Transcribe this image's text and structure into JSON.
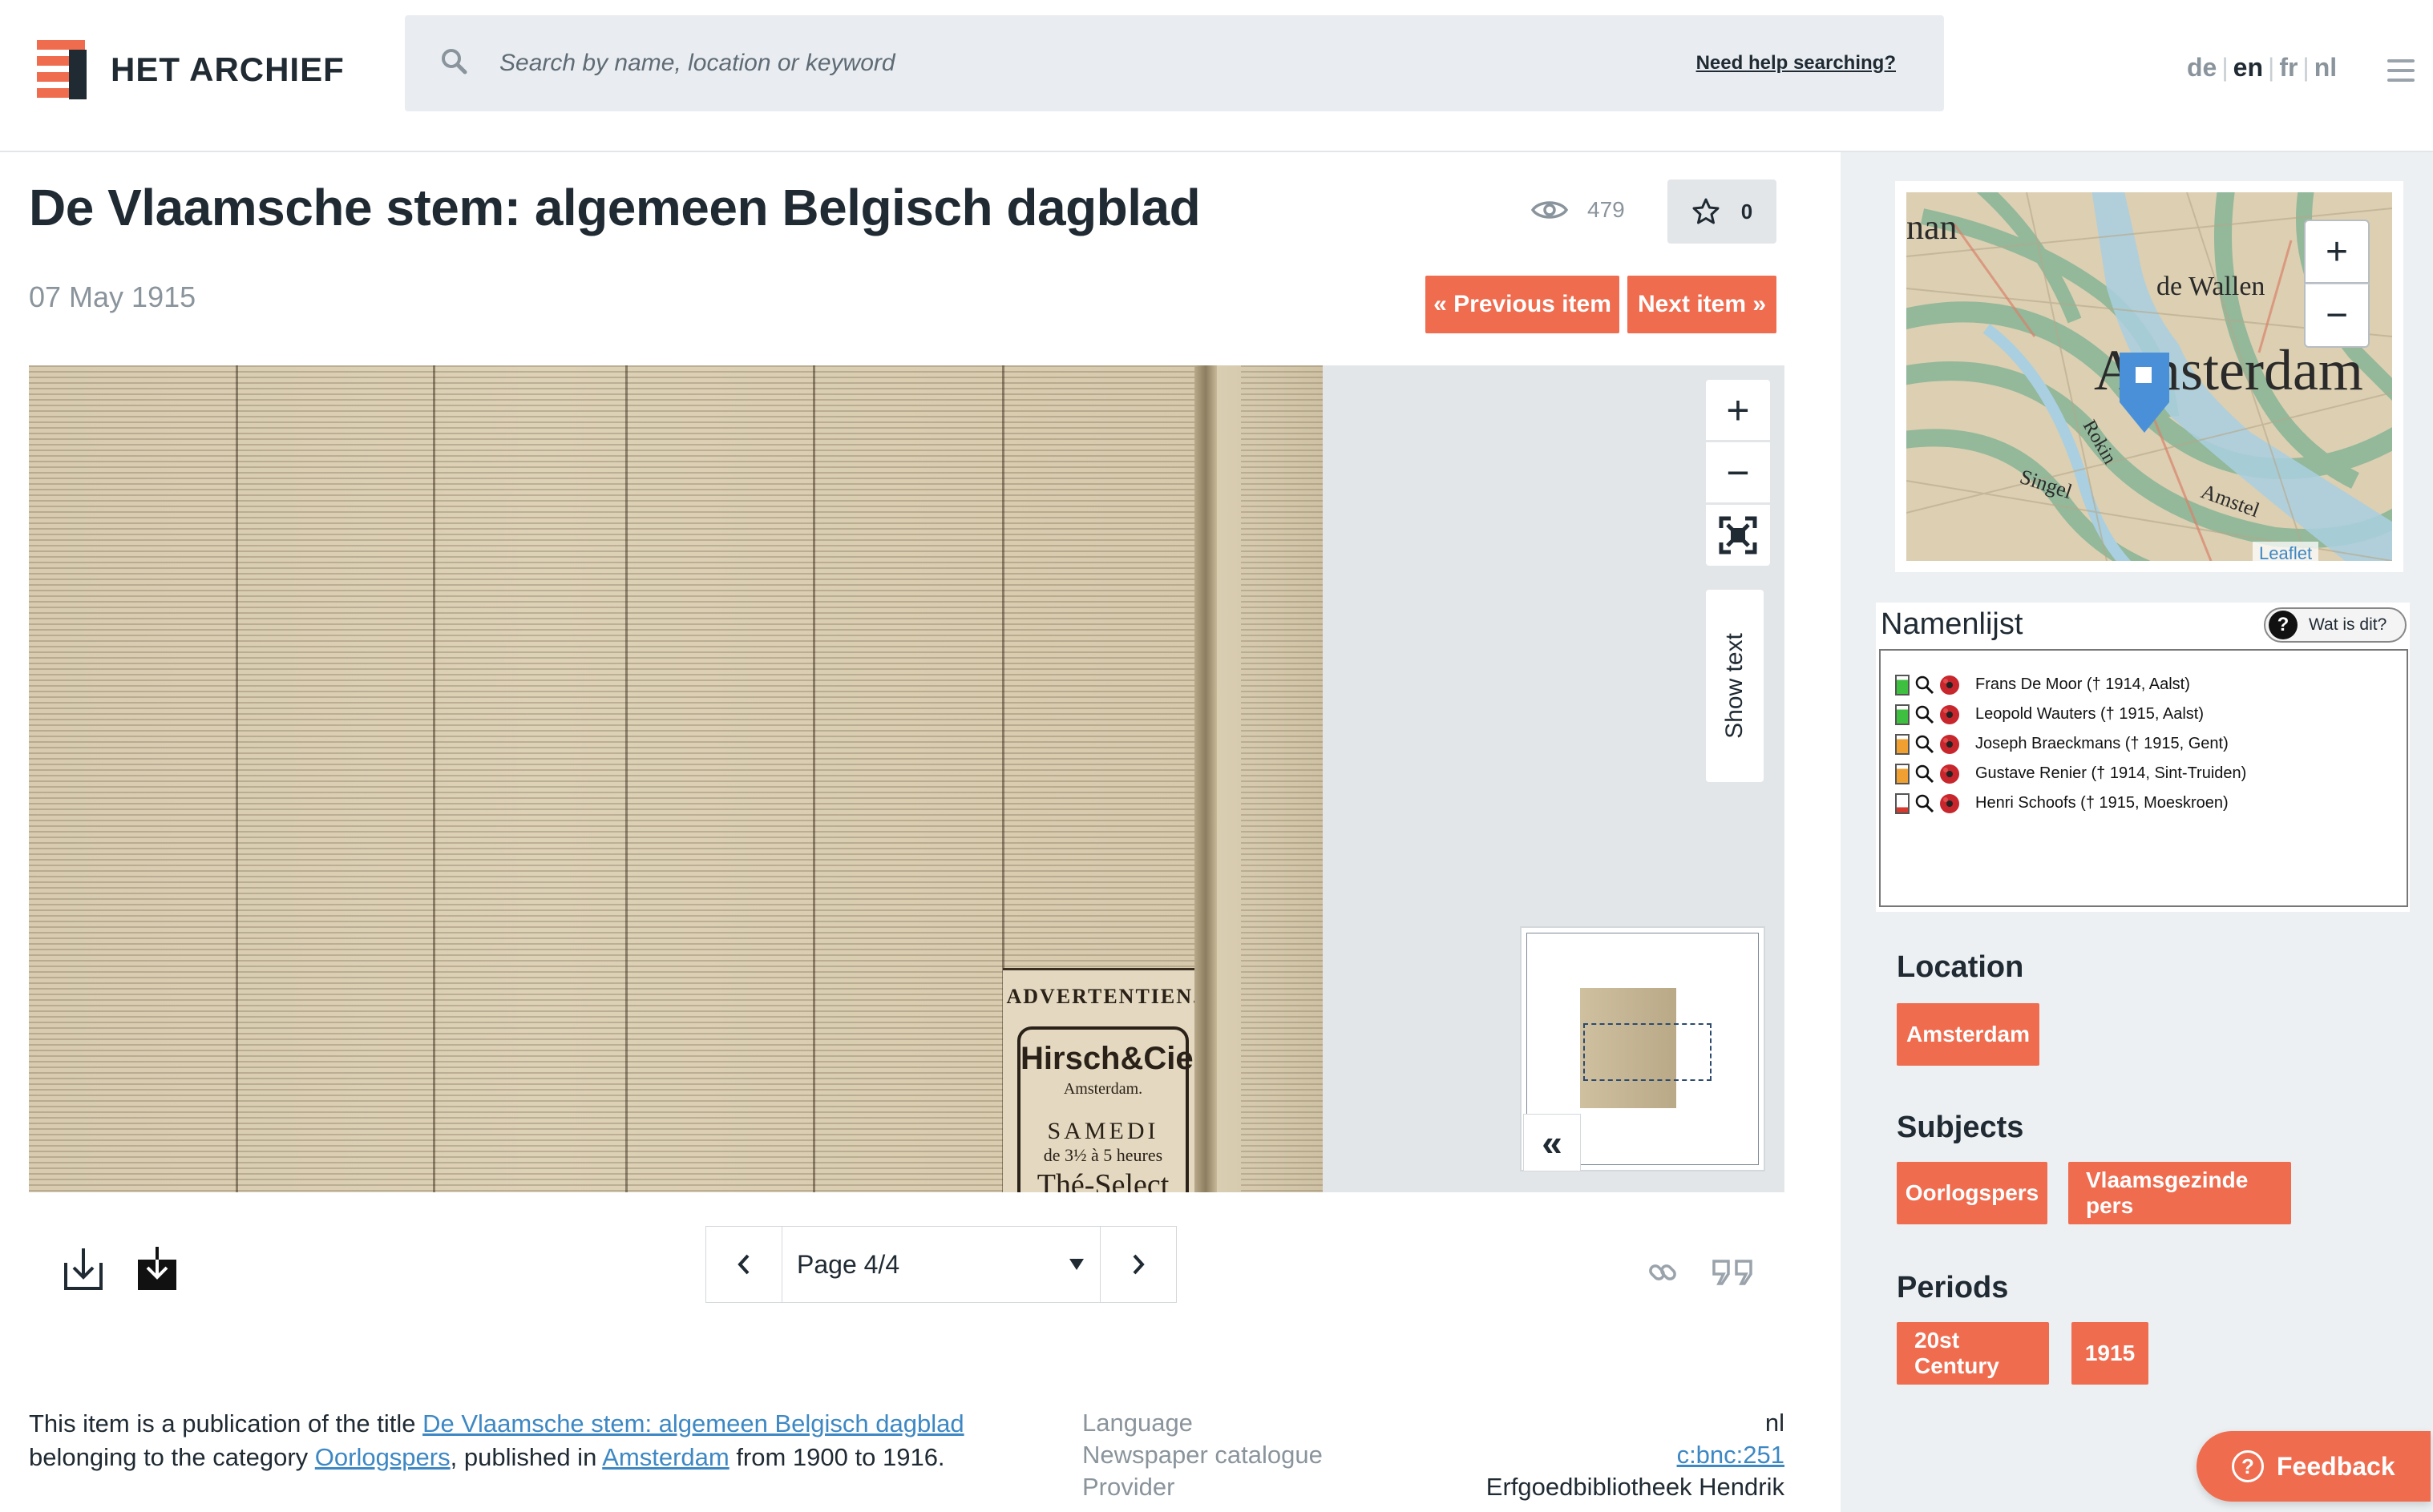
{
  "header": {
    "logo_text": "HET ARCHIEF",
    "search_placeholder": "Search by name, location or keyword",
    "search_help": "Need help searching?",
    "languages": [
      "de",
      "en",
      "fr",
      "nl"
    ],
    "active_language": "en"
  },
  "item": {
    "title": "De Vlaamsche stem: algemeen Belgisch dagblad",
    "date": "07 May 1915",
    "views": "479",
    "favorites": "0",
    "previous_label": "« Previous item",
    "next_label": "Next item »"
  },
  "viewer": {
    "show_text_label": "Show text",
    "page_label": "Page 4/4",
    "advert": {
      "heading": "ADVERTENTIEN.",
      "brand": "Hirsch&Cie",
      "city": "Amsterdam.",
      "day": "SAMEDI",
      "time": "de 3½ à 5 heures",
      "tea": "Thé-Select"
    },
    "collapse_label": "«"
  },
  "description": {
    "prefix": "This item is a publication of the title ",
    "title_link": "De Vlaamsche stem: algemeen Belgisch dagblad",
    "middle": " belonging to the category ",
    "category_link": "Oorlogspers",
    "published_in": ", published in ",
    "place_link": "Amsterdam",
    "suffix": " from 1900 to 1916."
  },
  "metadata": [
    {
      "key": "Language",
      "value": "nl",
      "link": false
    },
    {
      "key": "Newspaper catalogue",
      "value": "c:bnc:251",
      "link": true
    },
    {
      "key": "Provider",
      "value": "Erfgoedbibliotheek Hendrik",
      "link": false
    }
  ],
  "map": {
    "labels": {
      "city": "Amsterdam",
      "area": "de Wallen",
      "left": "nan",
      "canal1": "Singel",
      "canal2": "Rokin",
      "canal3": "Amstel"
    },
    "attribution": "Leaflet",
    "zoom_in": "+",
    "zoom_out": "−"
  },
  "namenlijst": {
    "title": "Namenlijst",
    "help_label": "Wat is dit?",
    "entries": [
      {
        "name": "Frans De Moor († 1914, Aalst)",
        "color": "#3fbf3f"
      },
      {
        "name": "Leopold Wauters († 1915, Aalst)",
        "color": "#3fbf3f"
      },
      {
        "name": "Joseph Braeckmans  († 1915, Gent)",
        "color": "#f0a030"
      },
      {
        "name": "Gustave Renier († 1914, Sint-Truiden)",
        "color": "#f0a030"
      },
      {
        "name": "Henri Schoofs († 1915, Moeskroen)",
        "color": "#d63a2e"
      }
    ]
  },
  "sidebar": {
    "location_label": "Location",
    "locations": [
      "Amsterdam"
    ],
    "subjects_label": "Subjects",
    "subjects": [
      "Oorlogspers",
      "Vlaamsgezinde pers"
    ],
    "periods_label": "Periods",
    "periods": [
      "20st Century",
      "1915"
    ]
  },
  "feedback_label": "Feedback",
  "colors": {
    "accent": "#ef6c4f",
    "link": "#3d88c4",
    "sidebar_bg": "#edf0f2"
  }
}
